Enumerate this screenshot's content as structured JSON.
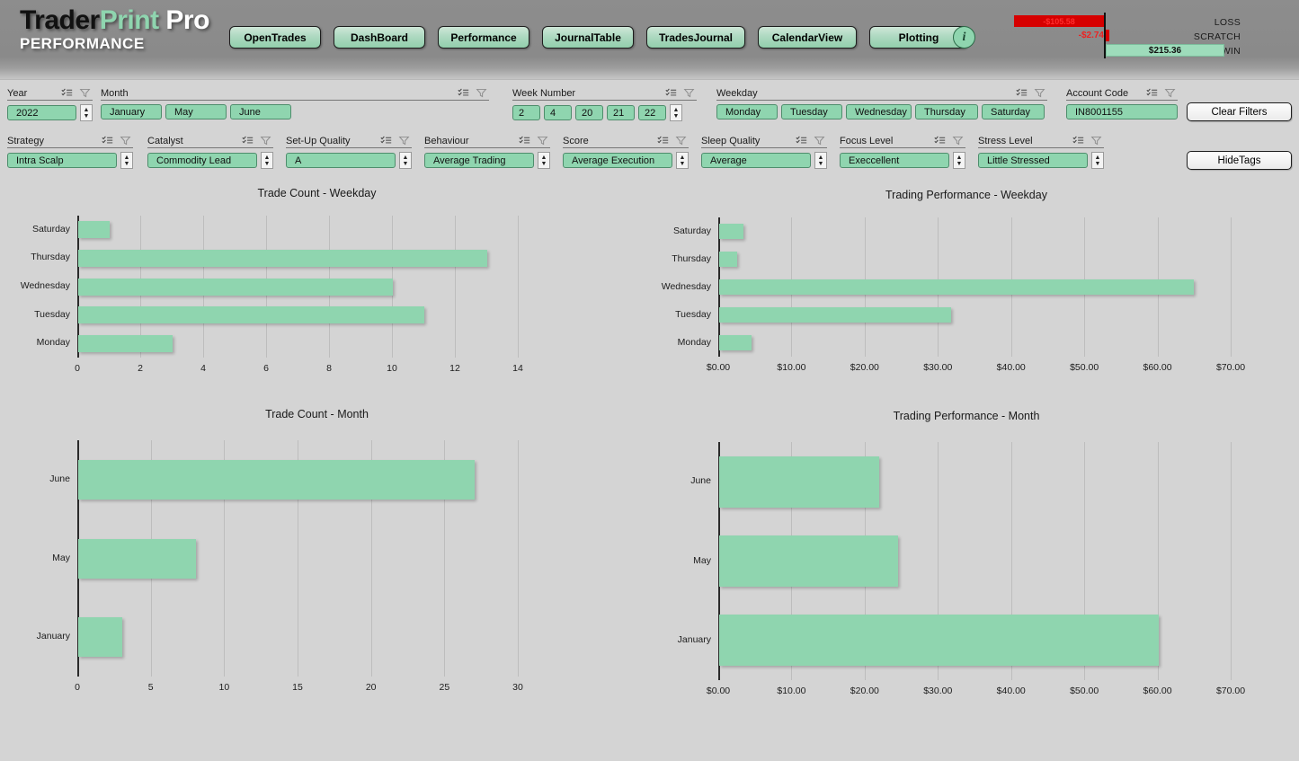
{
  "header": {
    "brand_trader": "Trader",
    "brand_print": "Print",
    "brand_pro": " Pro",
    "subtitle": "PERFORMANCE",
    "nav": [
      {
        "label": "OpenTrades"
      },
      {
        "label": "DashBoard"
      },
      {
        "label": "Performance"
      },
      {
        "label": "JournalTable"
      },
      {
        "label": "TradesJournal"
      },
      {
        "label": "CalendarView"
      },
      {
        "label": "Plotting"
      }
    ],
    "info_glyph": "i",
    "outcome": {
      "loss_label": "LOSS",
      "scratch_label": "SCRATCH",
      "win_label": "WIN",
      "loss_value": "-$105.58",
      "scratch_value": "-$2.74",
      "win_value": "$215.36"
    }
  },
  "filters": {
    "row1": [
      {
        "title": "Year",
        "values": [
          "2022"
        ],
        "spinner": true
      },
      {
        "title": "Month",
        "values": [
          "January",
          "May",
          "June"
        ],
        "spinner": false
      },
      {
        "title": "Week Number",
        "values": [
          "2",
          "4",
          "20",
          "21",
          "22"
        ],
        "spinner": true
      },
      {
        "title": "Weekday",
        "values": [
          "Monday",
          "Tuesday",
          "Wednesday",
          "Thursday",
          "Saturday"
        ],
        "spinner": false
      },
      {
        "title": "Account Code",
        "values": [
          "IN8001155"
        ],
        "spinner": false
      }
    ],
    "row2": [
      {
        "title": "Strategy",
        "values": [
          "Intra Scalp"
        ],
        "spinner": true
      },
      {
        "title": "Catalyst",
        "values": [
          "Commodity Lead"
        ],
        "spinner": true
      },
      {
        "title": "Set-Up Quality",
        "values": [
          "A"
        ],
        "spinner": true
      },
      {
        "title": "Behaviour",
        "values": [
          "Average Trading"
        ],
        "spinner": true
      },
      {
        "title": "Score",
        "values": [
          "Average Execution"
        ],
        "spinner": true
      },
      {
        "title": "Sleep Quality",
        "values": [
          "Average"
        ],
        "spinner": true
      },
      {
        "title": "Focus Level",
        "values": [
          "Execcellent"
        ],
        "spinner": true
      },
      {
        "title": "Stress Level",
        "values": [
          "Little Stressed"
        ],
        "spinner": true
      }
    ],
    "clear_filters_label": "Clear Filters",
    "hide_tags_label": "HideTags"
  },
  "colors": {
    "accent_green": "#8FD5AF",
    "panel_gray": "#d4d4d4",
    "header_gray": "#8a8a8a",
    "loss_red": "#d60000"
  },
  "chart_data": [
    {
      "type": "bar",
      "orientation": "horizontal",
      "title": "Trade Count - Weekday",
      "categories": [
        "Saturday",
        "Thursday",
        "Wednesday",
        "Tuesday",
        "Monday"
      ],
      "values": [
        1,
        13,
        10,
        11,
        3
      ],
      "ticks": [
        "0",
        "2",
        "4",
        "6",
        "8",
        "10",
        "12",
        "14"
      ],
      "tick_values": [
        0,
        2,
        4,
        6,
        8,
        10,
        12,
        14
      ],
      "xlim": [
        0,
        14
      ],
      "xlabel": "",
      "ylabel": "",
      "grid": true,
      "legend": "none"
    },
    {
      "type": "bar",
      "orientation": "horizontal",
      "title": "Trading Performance - Weekday",
      "categories": [
        "Saturday",
        "Thursday",
        "Wednesday",
        "Tuesday",
        "Monday"
      ],
      "values": [
        3.3,
        2.5,
        64.8,
        31.7,
        4.4
      ],
      "ticks": [
        "$0.00",
        "$10.00",
        "$20.00",
        "$30.00",
        "$40.00",
        "$50.00",
        "$60.00",
        "$70.00"
      ],
      "tick_values": [
        0,
        10,
        20,
        30,
        40,
        50,
        60,
        70
      ],
      "xlim": [
        0,
        70
      ],
      "xlabel": "",
      "ylabel": "",
      "grid": true,
      "legend": "none"
    },
    {
      "type": "bar",
      "orientation": "horizontal",
      "title": "Trade Count - Month",
      "categories": [
        "June",
        "May",
        "January"
      ],
      "values": [
        27,
        8,
        3
      ],
      "ticks": [
        "0",
        "5",
        "10",
        "15",
        "20",
        "25",
        "30"
      ],
      "tick_values": [
        0,
        5,
        10,
        15,
        20,
        25,
        30
      ],
      "xlim": [
        0,
        30
      ],
      "xlabel": "",
      "ylabel": "",
      "grid": true,
      "legend": "none"
    },
    {
      "type": "bar",
      "orientation": "horizontal",
      "title": "Trading Performance - Month",
      "categories": [
        "June",
        "May",
        "January"
      ],
      "values": [
        21.9,
        24.4,
        60.0
      ],
      "ticks": [
        "$0.00",
        "$10.00",
        "$20.00",
        "$30.00",
        "$40.00",
        "$50.00",
        "$60.00",
        "$70.00"
      ],
      "tick_values": [
        0,
        10,
        20,
        30,
        40,
        50,
        60,
        70
      ],
      "xlim": [
        0,
        70
      ],
      "xlabel": "",
      "ylabel": "",
      "grid": true,
      "legend": "none"
    }
  ]
}
